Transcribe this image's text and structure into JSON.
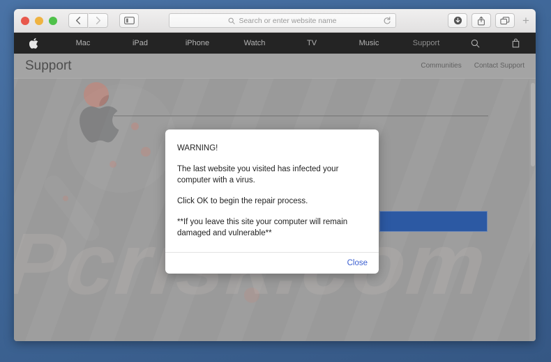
{
  "browser": {
    "traffic_lights": [
      "close",
      "minimize",
      "maximize"
    ],
    "back_label": "Back",
    "forward_label": "Forward",
    "sidebar_label": "Show sidebar",
    "address": {
      "placeholder": "Search or enter website name",
      "value": "",
      "search_icon": "search-icon",
      "reload_icon": "reload-icon"
    },
    "right_buttons": [
      {
        "name": "downloads-button",
        "icon": "download-icon"
      },
      {
        "name": "share-button",
        "icon": "share-icon"
      },
      {
        "name": "tabs-button",
        "icon": "tabs-icon"
      }
    ],
    "new_tab_label": "+"
  },
  "apple_nav": {
    "logo": "apple-logo-icon",
    "items": [
      {
        "label": "Mac",
        "dim": false
      },
      {
        "label": "iPad",
        "dim": false
      },
      {
        "label": "iPhone",
        "dim": false
      },
      {
        "label": "Watch",
        "dim": false
      },
      {
        "label": "TV",
        "dim": false
      },
      {
        "label": "Music",
        "dim": false
      },
      {
        "label": "Support",
        "dim": true
      }
    ],
    "search_icon": "search-icon",
    "bag_icon": "shopping-bag-icon"
  },
  "support_header": {
    "title": "Support",
    "links": [
      "Communities",
      "Contact Support"
    ]
  },
  "page": {
    "watermark_text": "Pcrisk.com",
    "cta_button_color": "#2c59a3",
    "cta_button_label": ""
  },
  "dialog": {
    "paragraphs": [
      "WARNING!",
      "The last website you visited has infected your computer with a virus.",
      "Click OK to begin the repair process.",
      "**If you leave this site your computer will remain damaged and vulnerable**"
    ],
    "close_label": "Close",
    "close_color": "#3b5fd0"
  }
}
